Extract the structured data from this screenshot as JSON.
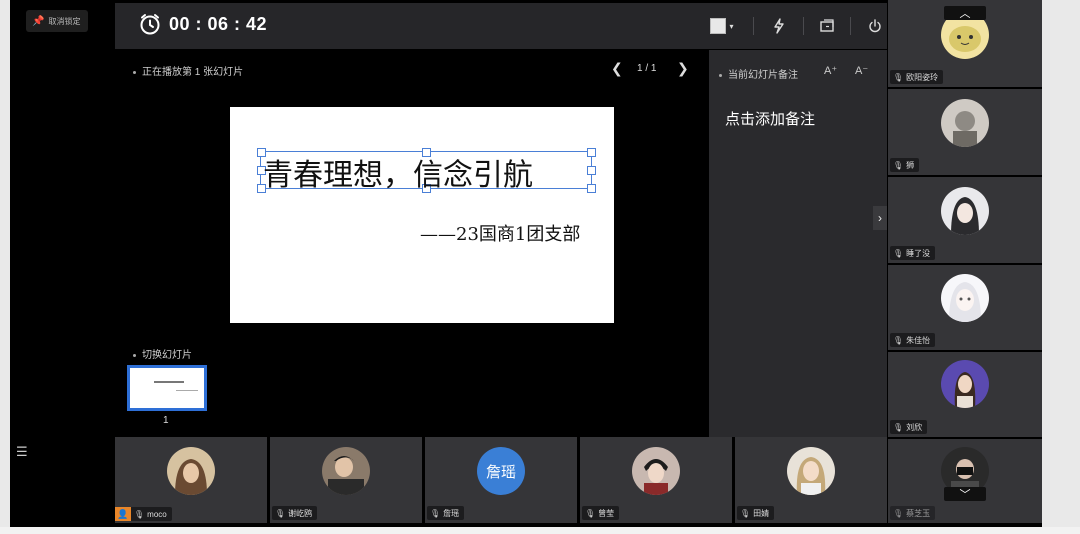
{
  "lock": {
    "label": "取消锁定"
  },
  "toolbar": {
    "timer": "00 : 06 : 42"
  },
  "slide_panel": {
    "play_status": "正在播放第 1 张幻灯片",
    "page_indicator": "1 / 1",
    "switch_label": "切换幻灯片",
    "thumb_number": "1"
  },
  "slide": {
    "title": "青春理想，信念引航",
    "subtitle": "——23国商1团支部"
  },
  "notes": {
    "header": "当前幻灯片备注",
    "font_increase": "A⁺",
    "font_decrease": "A⁻",
    "placeholder": "点击添加备注"
  },
  "right_participants": [
    {
      "name": "欧阳姿玲",
      "avatar_color": "#d9c86a"
    },
    {
      "name": "狮",
      "avatar_color": "#8e8a84"
    },
    {
      "name": "睡了没",
      "avatar_color": "#2b2b2e"
    },
    {
      "name": "朱佳怡",
      "avatar_color": "#e4e4ea"
    },
    {
      "name": "刘欣",
      "avatar_color": "#5a4ab0"
    },
    {
      "name": "蔡芝玉",
      "avatar_color": "#4a4a4a"
    }
  ],
  "bottom_participants": [
    {
      "name": "moco",
      "avatar_color": "#b08a5a",
      "host": true
    },
    {
      "name": "谢屹鸥",
      "avatar_color": "#5a4a3e"
    },
    {
      "name": "詹瑶",
      "avatar_text": "詹瑶",
      "avatar_color": "#3a7fd6"
    },
    {
      "name": "曾莹",
      "avatar_color": "#4a3a36"
    },
    {
      "name": "田婧",
      "avatar_color": "#c4a878"
    }
  ]
}
